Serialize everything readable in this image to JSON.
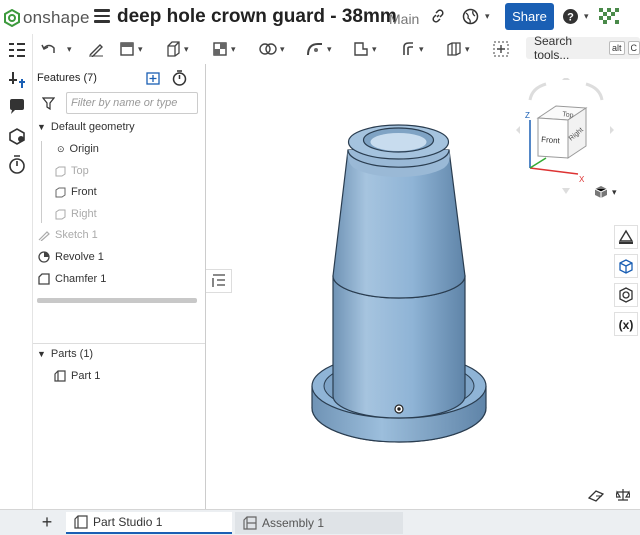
{
  "app": {
    "brand": "onshape",
    "title": "deep hole crown guard - 38mm",
    "branch": "Main",
    "share_label": "Share"
  },
  "toolbar": {
    "search_label": "Search tools...",
    "kbd1": "alt",
    "kbd2": "C"
  },
  "features": {
    "title": "Features (7)",
    "filter_placeholder": "Filter by name or type",
    "default_geometry": "Default geometry",
    "origin": "Origin",
    "top": "Top",
    "front": "Front",
    "right": "Right",
    "sketch": "Sketch 1",
    "revolve": "Revolve 1",
    "chamfer": "Chamfer 1"
  },
  "parts": {
    "title": "Parts (1)",
    "part1": "Part 1"
  },
  "viewcube": {
    "top": "Top",
    "front": "Front",
    "right": "Right",
    "z": "Z",
    "x": "X",
    "y": "Y"
  },
  "tabs": [
    {
      "label": "Part Studio 1"
    },
    {
      "label": "Assembly 1"
    }
  ],
  "colors": {
    "accent": "#1a5fb4",
    "part": "#8fb4d6",
    "part_dark": "#6f93b5",
    "tab_active": "#1a5fb4"
  }
}
